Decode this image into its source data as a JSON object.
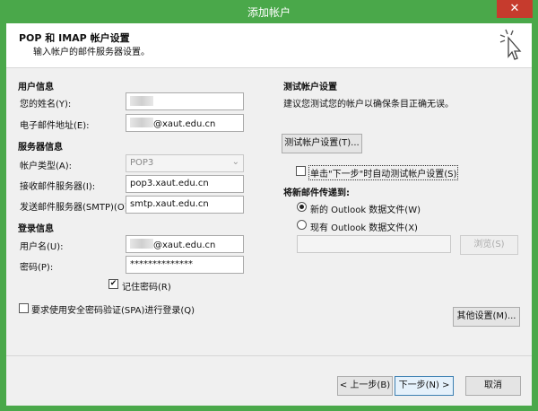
{
  "window": {
    "title": "添加帐户",
    "close_symbol": "✕"
  },
  "header": {
    "title": "POP 和 IMAP 帐户设置",
    "subtitle": "输入帐户的邮件服务器设置。"
  },
  "user_info": {
    "section": "用户信息",
    "name_label": "您的姓名(Y):",
    "name_value": "",
    "email_label": "电子邮件地址(E):",
    "email_value": "@xaut.edu.cn"
  },
  "server_info": {
    "section": "服务器信息",
    "account_type_label": "帐户类型(A):",
    "account_type_value": "POP3",
    "incoming_label": "接收邮件服务器(I):",
    "incoming_value": "pop3.xaut.edu.cn",
    "outgoing_label": "发送邮件服务器(SMTP)(O):",
    "outgoing_value": "smtp.xaut.edu.cn"
  },
  "login_info": {
    "section": "登录信息",
    "username_label": "用户名(U):",
    "username_value": "@xaut.edu.cn",
    "password_label": "密码(P):",
    "password_value": "**************",
    "remember_label": "记住密码(R)",
    "remember_checked": true,
    "spa_label": "要求使用安全密码验证(SPA)进行登录(Q)",
    "spa_checked": false
  },
  "test_settings": {
    "section": "测试帐户设置",
    "description": "建议您测试您的帐户以确保条目正确无误。",
    "test_button": "测试帐户设置(T)...",
    "auto_test_label": "单击\"下一步\"时自动测试帐户设置(S)",
    "auto_test_checked": false
  },
  "deliver": {
    "section": "将新邮件传递到:",
    "new_file_label": "新的 Outlook 数据文件(W)",
    "existing_file_label": "现有 Outlook 数据文件(X)",
    "selected": "new",
    "path_value": "",
    "browse_button": "浏览(S)"
  },
  "more_settings_button": "其他设置(M)...",
  "footer": {
    "back_button": "< 上一步(B)",
    "next_button": "下一步(N) >",
    "cancel_button": "取消"
  }
}
